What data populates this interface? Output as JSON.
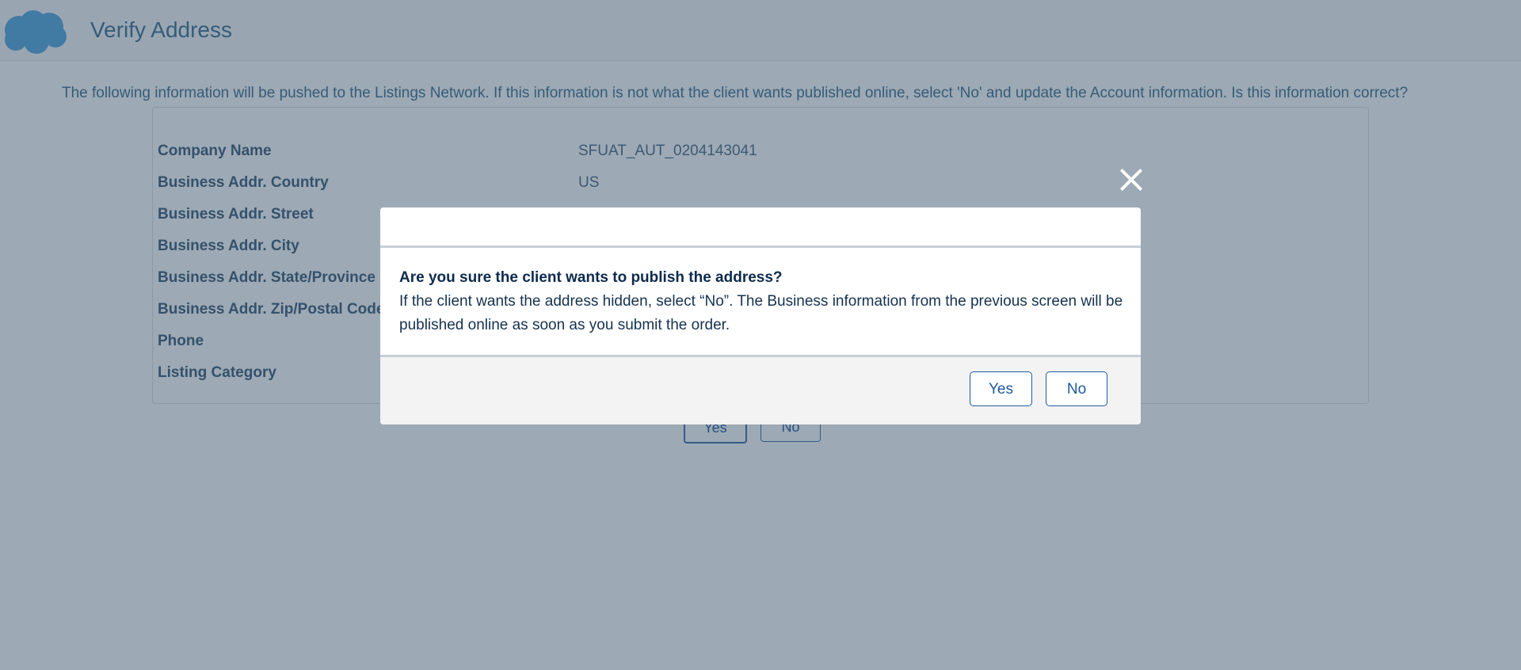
{
  "header": {
    "title": "Verify Address",
    "logo_icon": "salesforce-cloud-icon"
  },
  "intro_text": "The following information will be pushed to the Listings Network. If this information is not what the client wants published online, select 'No' and update the Account information. Is this information correct?",
  "fields": [
    {
      "label": "Company Name",
      "value": "SFUAT_AUT_0204143041"
    },
    {
      "label": "Business Addr. Country",
      "value": "US"
    },
    {
      "label": "Business Addr. Street",
      "value": ""
    },
    {
      "label": "Business Addr. City",
      "value": ""
    },
    {
      "label": "Business Addr. State/Province",
      "value": ""
    },
    {
      "label": "Business Addr. Zip/Postal Code",
      "value": ""
    },
    {
      "label": "Phone",
      "value": ""
    },
    {
      "label": "Listing Category",
      "value": ""
    }
  ],
  "background_buttons": {
    "yes_label": "Yes",
    "no_label": "No"
  },
  "modal": {
    "close_icon": "close-icon",
    "heading": "Are you sure the client wants to publish the address?",
    "body": "If the client wants the address hidden, select “No”. The Business information from the previous screen will be published online as soon as you submit the order.",
    "yes_label": "Yes",
    "no_label": "No"
  },
  "colors": {
    "accent": "#1f5aa0",
    "overlay": "#2e4860",
    "heading_text": "#0d2b4d"
  }
}
